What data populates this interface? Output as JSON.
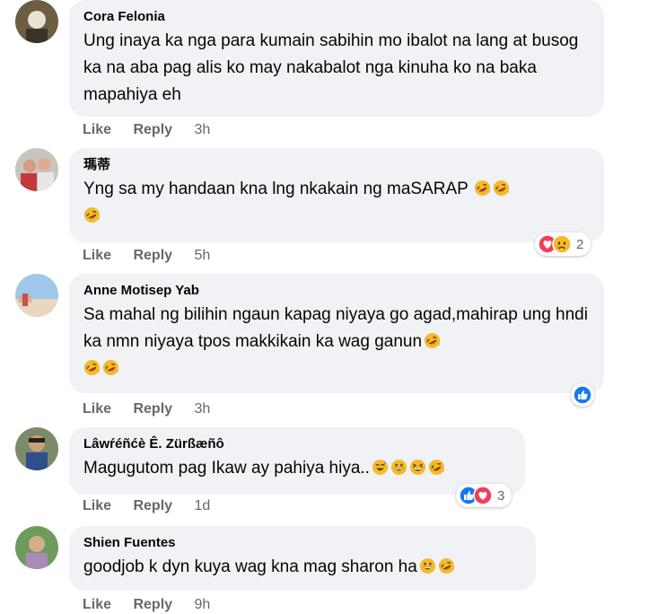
{
  "comments": [
    {
      "author": "Cora Felonia",
      "text": "Ung inaya ka nga para kumain sabihin mo ibalot na lang at busog ka na aba pag alis ko may nakabalot nga kinuha ko na baka mapahiya eh",
      "actions": {
        "like": "Like",
        "reply": "Reply",
        "time": "3h"
      }
    },
    {
      "author": "瑪蒂",
      "text": "Yng sa my handaan kna lng nkakain ng maSARAP",
      "emoji_trailing": [
        "rofl-emoji",
        "rofl-emoji",
        "rofl-emoji"
      ],
      "reactions": {
        "icons": [
          "love-reaction-icon",
          "sad-reaction-icon"
        ],
        "count": "2"
      },
      "actions": {
        "like": "Like",
        "reply": "Reply",
        "time": "5h"
      }
    },
    {
      "author": "Anne Motisep Yab",
      "text": "Sa mahal ng bilihin ngaun kapag niyaya go agad,mahirap ung hndi ka nmn niyaya tpos makkikain ka wag ganun",
      "emoji_trailing": [
        "rofl-emoji",
        "rofl-emoji",
        "rofl-emoji"
      ],
      "reactions": {
        "icons": [
          "like-reaction-icon"
        ],
        "count": ""
      },
      "actions": {
        "like": "Like",
        "reply": "Reply",
        "time": "3h"
      }
    },
    {
      "author": "Lâwŕéñćè Ê. Zürßæñô",
      "text": "Magugutom pag Ikaw ay pahiya hiya..",
      "emoji_trailing": [
        "sweat-smile-emoji",
        "grin-emoji",
        "grin-squint-emoji",
        "rofl-emoji"
      ],
      "reactions": {
        "icons": [
          "like-reaction-icon",
          "love-reaction-icon"
        ],
        "count": "3"
      },
      "actions": {
        "like": "Like",
        "reply": "Reply",
        "time": "1d"
      }
    },
    {
      "author": "Shien Fuentes",
      "text": "goodjob k dyn kuya wag kna mag sharon ha",
      "emoji_trailing": [
        "grin-emoji",
        "rofl-emoji"
      ],
      "actions": {
        "like": "Like",
        "reply": "Reply",
        "time": "9h"
      }
    }
  ],
  "colors": {
    "bubble": "#f0f2f5",
    "text": "#050505",
    "secondary": "#65676b",
    "like_blue": "#1877f2",
    "love_red": "#f33e58",
    "emoji_yellow": "#f7b928"
  }
}
